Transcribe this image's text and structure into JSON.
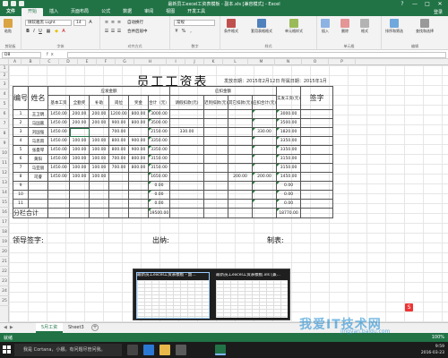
{
  "window": {
    "title": "最新员工excel工资表模板 - 副本.xls [兼容模式] - Excel",
    "controls": [
      "?",
      "—",
      "□",
      "✕"
    ]
  },
  "ribbon": {
    "tabs": [
      "文件",
      "开始",
      "插入",
      "页面布局",
      "公式",
      "数据",
      "审阅",
      "视图",
      "开发工具"
    ],
    "active_tab": "开始",
    "user": "登录",
    "font_name": "微软雅黑 Light",
    "font_size": "14",
    "groups": {
      "clipboard": "剪贴板",
      "font": "字体",
      "alignment": "对齐方式",
      "number": "数字",
      "styles": "样式",
      "cells": "单元格",
      "editing": "编辑"
    },
    "buttons": {
      "paste": "粘贴",
      "wrap": "自动换行",
      "merge": "合并后居中",
      "number_format": "常规",
      "conditional": "条件格式",
      "table_format": "套用表格格式",
      "cell_style": "单元格样式",
      "insert": "插入",
      "delete": "删除",
      "format": "格式",
      "sort": "排序和筛选",
      "find": "查找和选择"
    }
  },
  "formula_bar": {
    "name_box": "D8",
    "fx": "fx",
    "value": ""
  },
  "sheet": {
    "columns": [
      "A",
      "B",
      "C",
      "D",
      "E",
      "F",
      "G",
      "H",
      "I",
      "J",
      "K",
      "L",
      "M",
      "N",
      "O",
      "P"
    ],
    "rows": [
      "1",
      "2",
      "3",
      "4",
      "5",
      "6",
      "7",
      "8",
      "9",
      "10",
      "11",
      "12",
      "13",
      "14",
      "15",
      "16",
      "17",
      "18",
      "19",
      "20",
      "21",
      "22",
      "23",
      "24",
      "25"
    ],
    "title": "员工工资表",
    "issue_info": "发放日期：2015年2月12日  所属日期：2015年1月",
    "headers": {
      "num": "编号",
      "name": "姓名",
      "payable": "应发金额",
      "base": "基本工资",
      "perf": "全勤奖",
      "subsidy": "补助",
      "post": "岗位",
      "bonus": "奖金",
      "total": "合计（元）",
      "deduct": "应扣金额",
      "late": "请假扣款(元)",
      "social": "迟到扣款(元)",
      "other": "其它扣款(元)",
      "deduct_total": "应扣合计(元)",
      "actual": "实发工资(元)",
      "sign": "签字"
    },
    "employees": [
      {
        "no": "1",
        "name": "王卫明",
        "base": "1450.00",
        "perf": "200.00",
        "subsidy": "200.00",
        "post": "1200.00",
        "bonus": "800.00",
        "total": "3000.00",
        "late": "",
        "social": "",
        "other": "",
        "dtotal": "",
        "actual": "3000.00"
      },
      {
        "no": "2",
        "name": "马国嘉",
        "base": "1450.00",
        "perf": "200.00",
        "subsidy": "200.00",
        "post": "900.00",
        "bonus": "800.00",
        "total": "3500.00",
        "late": "",
        "social": "",
        "other": "",
        "dtotal": "",
        "actual": "3500.00"
      },
      {
        "no": "3",
        "name": "刘国强",
        "base": "1450.00",
        "perf": "",
        "subsidy": "",
        "post": "700.00",
        "bonus": "",
        "total": "2150.00",
        "late": "330.00",
        "social": "",
        "other": "",
        "dtotal": "330.00",
        "actual": "1820.00"
      },
      {
        "no": "4",
        "name": "马思雨",
        "base": "1450.00",
        "perf": "100.00",
        "subsidy": "100.00",
        "post": "800.00",
        "bonus": "900.00",
        "total": "3350.00",
        "late": "",
        "social": "",
        "other": "",
        "dtotal": "",
        "actual": "3350.00"
      },
      {
        "no": "5",
        "name": "张曼琴",
        "base": "1450.00",
        "perf": "100.00",
        "subsidy": "100.00",
        "post": "800.00",
        "bonus": "900.00",
        "total": "3350.00",
        "late": "",
        "social": "",
        "other": "",
        "dtotal": "",
        "actual": "3350.00"
      },
      {
        "no": "6",
        "name": "黄阳",
        "base": "1450.00",
        "perf": "100.00",
        "subsidy": "100.00",
        "post": "700.00",
        "bonus": "800.00",
        "total": "3150.00",
        "late": "",
        "social": "",
        "other": "",
        "dtotal": "",
        "actual": "3150.00"
      },
      {
        "no": "7",
        "name": "马亚丽",
        "base": "1450.00",
        "perf": "100.00",
        "subsidy": "100.00",
        "post": "700.00",
        "bonus": "800.00",
        "total": "3150.00",
        "late": "",
        "social": "",
        "other": "",
        "dtotal": "",
        "actual": "3150.00"
      },
      {
        "no": "8",
        "name": "司睿",
        "base": "1450.00",
        "perf": "100.00",
        "subsidy": "100.00",
        "post": "",
        "bonus": "",
        "total": "1650.00",
        "late": "",
        "social": "",
        "other": "200.00",
        "dtotal": "200.00",
        "actual": "1450.00"
      },
      {
        "no": "9",
        "name": "",
        "base": "",
        "perf": "",
        "subsidy": "",
        "post": "",
        "bonus": "",
        "total": "0.00",
        "late": "",
        "social": "",
        "other": "",
        "dtotal": "",
        "actual": "0.00"
      },
      {
        "no": "10",
        "name": "",
        "base": "",
        "perf": "",
        "subsidy": "",
        "post": "",
        "bonus": "",
        "total": "0.00",
        "late": "",
        "social": "",
        "other": "",
        "dtotal": "",
        "actual": "0.00"
      },
      {
        "no": "11",
        "name": "",
        "base": "",
        "perf": "",
        "subsidy": "",
        "post": "",
        "bonus": "",
        "total": "0.00",
        "late": "",
        "social": "",
        "other": "",
        "dtotal": "",
        "actual": "0.00"
      }
    ],
    "subtotal_label": "分栏合计",
    "subtotal_total": "19500.00",
    "subtotal_actual": "18770.00",
    "signatures": {
      "leader": "领导签字:",
      "cashier": "出纳:",
      "maker": "制表:"
    }
  },
  "sheet_tabs": {
    "tabs": [
      "5月工资",
      "Sheet3"
    ],
    "active": "5月工资",
    "add": "+"
  },
  "statusbar": {
    "ready": "就绪",
    "zoom": "100%"
  },
  "taskbar": {
    "search": "我是 Cortana，小娜。有问题尽管问我。",
    "thumb1": "最新员工excel工资表模板 - 副...",
    "thumb2": "最新员工excel工资表模板.xls [兼...",
    "time": "9:59",
    "date": "2016-03-23"
  },
  "watermark": {
    "text": "我爱IT技术网",
    "url": "jingyan.baidu.com"
  },
  "colors": {
    "accent": "#217346",
    "taskbar": "#1b1b1b"
  }
}
